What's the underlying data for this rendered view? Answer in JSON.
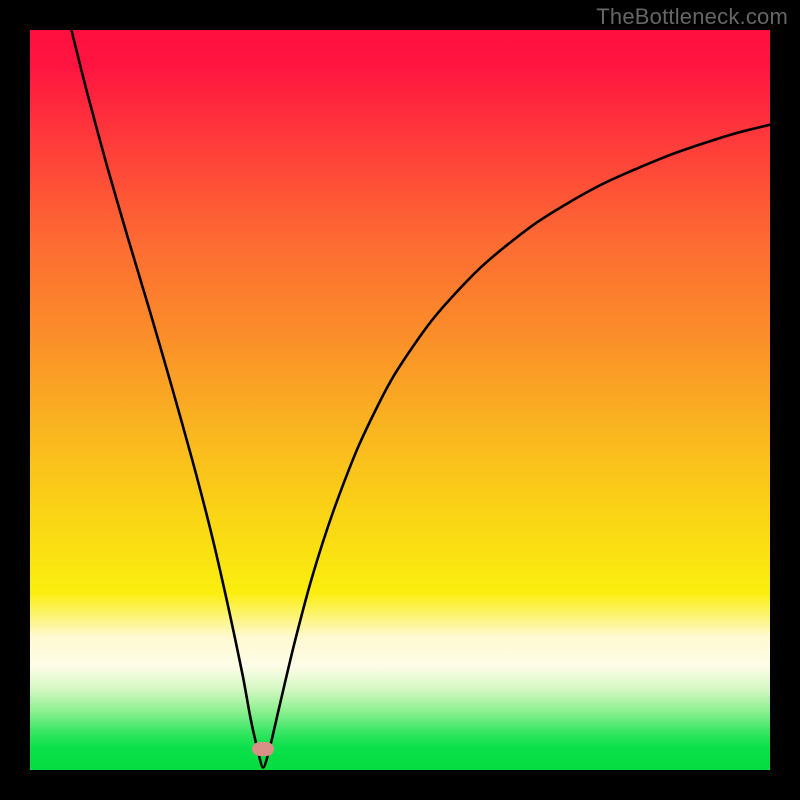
{
  "watermark": "TheBottleneck.com",
  "chart_data": {
    "type": "line",
    "title": "",
    "xlabel": "",
    "ylabel": "",
    "xlim": [
      0,
      100
    ],
    "ylim": [
      0,
      100
    ],
    "background_gradient": {
      "orientation": "vertical",
      "stops": [
        {
          "p": 0,
          "color": "#ff0f3f"
        },
        {
          "p": 28,
          "color": "#fd6933"
        },
        {
          "p": 55,
          "color": "#fab81f"
        },
        {
          "p": 76,
          "color": "#fbee0e"
        },
        {
          "p": 86,
          "color": "#fdfde8"
        },
        {
          "p": 95,
          "color": "#34e561"
        },
        {
          "p": 100,
          "color": "#02dd40"
        }
      ]
    },
    "marker": {
      "x_fraction": 0.315,
      "y_fraction": 0.972
    },
    "series": [
      {
        "name": "bottleneck-curve",
        "color": "#000000",
        "points": [
          {
            "x": 0.056,
            "y": 1.0
          },
          {
            "x": 0.076,
            "y": 0.92
          },
          {
            "x": 0.103,
            "y": 0.82
          },
          {
            "x": 0.132,
            "y": 0.72
          },
          {
            "x": 0.162,
            "y": 0.62
          },
          {
            "x": 0.191,
            "y": 0.52
          },
          {
            "x": 0.219,
            "y": 0.42
          },
          {
            "x": 0.245,
            "y": 0.32
          },
          {
            "x": 0.268,
            "y": 0.22
          },
          {
            "x": 0.287,
            "y": 0.13
          },
          {
            "x": 0.298,
            "y": 0.07
          },
          {
            "x": 0.307,
            "y": 0.03
          },
          {
            "x": 0.315,
            "y": 0.003
          },
          {
            "x": 0.324,
            "y": 0.03
          },
          {
            "x": 0.338,
            "y": 0.09
          },
          {
            "x": 0.357,
            "y": 0.17
          },
          {
            "x": 0.381,
            "y": 0.26
          },
          {
            "x": 0.41,
            "y": 0.35
          },
          {
            "x": 0.445,
            "y": 0.44
          },
          {
            "x": 0.49,
            "y": 0.53
          },
          {
            "x": 0.545,
            "y": 0.61
          },
          {
            "x": 0.61,
            "y": 0.68
          },
          {
            "x": 0.685,
            "y": 0.74
          },
          {
            "x": 0.77,
            "y": 0.79
          },
          {
            "x": 0.862,
            "y": 0.83
          },
          {
            "x": 0.945,
            "y": 0.858
          },
          {
            "x": 1.0,
            "y": 0.872
          }
        ]
      }
    ]
  }
}
